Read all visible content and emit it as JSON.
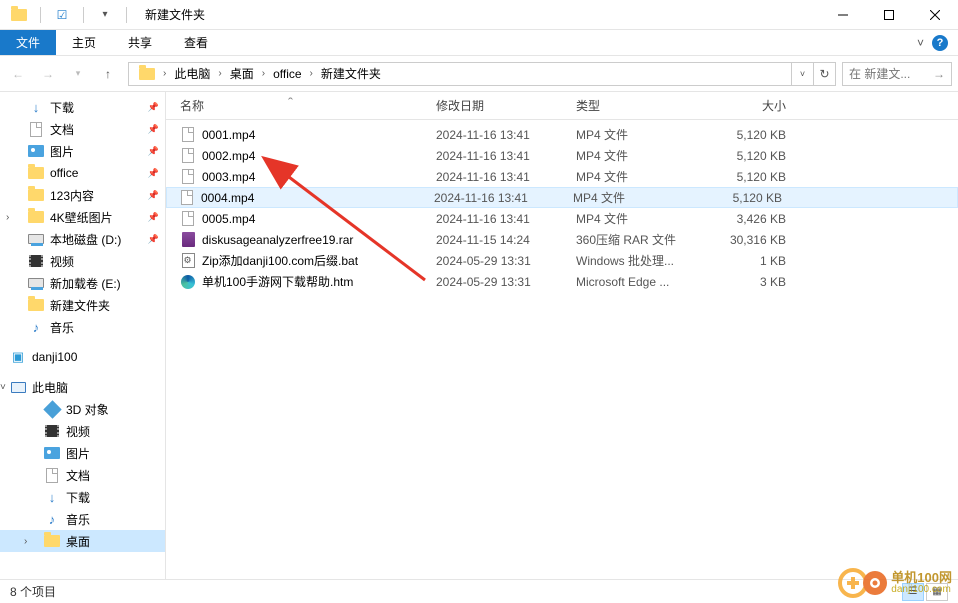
{
  "window": {
    "title": "新建文件夹"
  },
  "ribbon": {
    "file": "文件",
    "tabs": [
      "主页",
      "共享",
      "查看"
    ]
  },
  "breadcrumb": {
    "parts": [
      "此电脑",
      "桌面",
      "office",
      "新建文件夹"
    ]
  },
  "search": {
    "placeholder": "在 新建文..."
  },
  "sidebar": {
    "quick": [
      {
        "label": "下载",
        "pinned": true,
        "iconCls": "dl-icon",
        "glyph": "↓"
      },
      {
        "label": "文档",
        "pinned": true,
        "iconCls": "blank-icon"
      },
      {
        "label": "图片",
        "pinned": true,
        "iconCls": "pic-icon"
      },
      {
        "label": "office",
        "pinned": true,
        "iconCls": "folder-icon"
      },
      {
        "label": "123内容",
        "pinned": true,
        "iconCls": "folder-icon"
      },
      {
        "label": "4K壁纸图片",
        "pinned": true,
        "iconCls": "folder-icon"
      },
      {
        "label": "本地磁盘 (D:)",
        "pinned": true,
        "iconCls": "drive-icon"
      },
      {
        "label": "视频",
        "pinned": false,
        "iconCls": "video-icon"
      },
      {
        "label": "新加载卷 (E:)",
        "pinned": false,
        "iconCls": "drive-icon"
      },
      {
        "label": "新建文件夹",
        "pinned": false,
        "iconCls": "folder-icon"
      },
      {
        "label": "音乐",
        "pinned": false,
        "iconCls": "music-icon",
        "glyph": "♪"
      }
    ],
    "danji": "danji100",
    "thispc_label": "此电脑",
    "thispc": [
      {
        "label": "3D 对象",
        "iconCls": "obj3d-icon"
      },
      {
        "label": "视频",
        "iconCls": "video-icon"
      },
      {
        "label": "图片",
        "iconCls": "pic-icon"
      },
      {
        "label": "文档",
        "iconCls": "blank-icon"
      },
      {
        "label": "下载",
        "iconCls": "dl-icon",
        "glyph": "↓"
      },
      {
        "label": "音乐",
        "iconCls": "music-icon",
        "glyph": "♪"
      },
      {
        "label": "桌面",
        "iconCls": "folder-icon",
        "selected": true
      }
    ]
  },
  "columns": {
    "name": "名称",
    "date": "修改日期",
    "type": "类型",
    "size": "大小"
  },
  "files": [
    {
      "name": "0001.mp4",
      "date": "2024-11-16 13:41",
      "type": "MP4 文件",
      "size": "5,120 KB",
      "iconCls": "blank-icon"
    },
    {
      "name": "0002.mp4",
      "date": "2024-11-16 13:41",
      "type": "MP4 文件",
      "size": "5,120 KB",
      "iconCls": "blank-icon"
    },
    {
      "name": "0003.mp4",
      "date": "2024-11-16 13:41",
      "type": "MP4 文件",
      "size": "5,120 KB",
      "iconCls": "blank-icon"
    },
    {
      "name": "0004.mp4",
      "date": "2024-11-16 13:41",
      "type": "MP4 文件",
      "size": "5,120 KB",
      "iconCls": "blank-icon",
      "hover": true
    },
    {
      "name": "0005.mp4",
      "date": "2024-11-16 13:41",
      "type": "MP4 文件",
      "size": "3,426 KB",
      "iconCls": "blank-icon"
    },
    {
      "name": "diskusageanalyzerfree19.rar",
      "date": "2024-11-15 14:24",
      "type": "360压缩 RAR 文件",
      "size": "30,316 KB",
      "iconCls": "rar-icon"
    },
    {
      "name": "Zip添加danji100.com后缀.bat",
      "date": "2024-05-29 13:31",
      "type": "Windows 批处理...",
      "size": "1 KB",
      "iconCls": "bat-icon"
    },
    {
      "name": "单机100手游网下载帮助.htm",
      "date": "2024-05-29 13:31",
      "type": "Microsoft Edge ...",
      "size": "3 KB",
      "iconCls": "edge-icon"
    }
  ],
  "status": {
    "count": "8 个项目"
  },
  "watermark": {
    "title": "单机100网",
    "sub": "danji100.com"
  }
}
